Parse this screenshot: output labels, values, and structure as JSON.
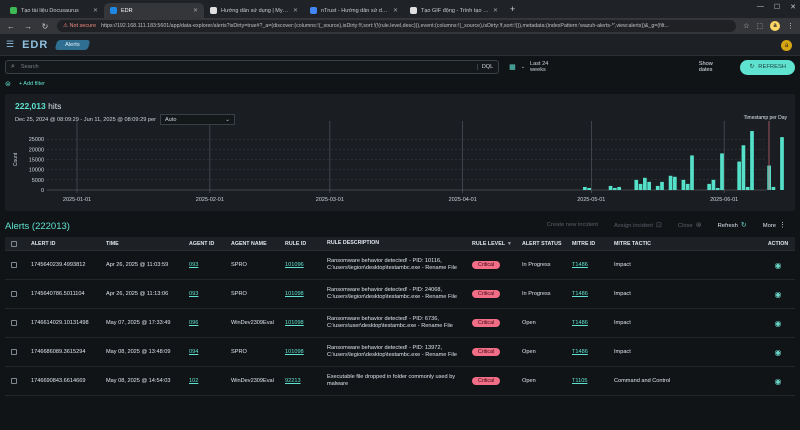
{
  "browser": {
    "tabs": [
      {
        "title": "Tạo tài liệu Docusaurus",
        "color": "#3cba54",
        "active": false
      },
      {
        "title": "EDR",
        "color": "#1e88e5",
        "active": true
      },
      {
        "title": "Hướng dẫn sử dụng | My EDR",
        "color": "#e0e0e0",
        "active": false
      },
      {
        "title": "nTrust - Hướng dẫn sử dụng",
        "color": "#4285f4",
        "active": false
      },
      {
        "title": "Tạo GIF động - Trình tạo GIF tr...",
        "color": "#e0e0e0",
        "active": false
      }
    ],
    "not_secure": "Not secure",
    "url": "https://192.168.111.183:5601/app/data-explorer/alerts?isDirty=true#?_a=(discover:(columns:!(_source),isDirty:!f,sort:!(!(rule.level,desc))),event:(columns:!(_source),isDirty:!f,sort:!()),metadata:(indexPattern:'wazuh-alerts-*',view:alerts))&_g=(filt...",
    "profile_initial": "a"
  },
  "app": {
    "logo": "EDR",
    "breadcrumb": "Alerts",
    "avatar": "a"
  },
  "query": {
    "placeholder": "Search",
    "dql": "DQL",
    "time_range": "Last 24 weeks",
    "show_dates": "Show dates",
    "refresh": "REFRESH",
    "add_filter": "+ Add filter"
  },
  "histogram": {
    "hits_value": "222,013",
    "hits_label": " hits",
    "date_range": "Dec 25, 2024 @ 08:09:29 - Jun 11, 2025 @ 08:09:29 per",
    "interval": "Auto",
    "corner_label": "Timestamp per Day"
  },
  "chart_data": {
    "type": "bar",
    "ylabel": "Count",
    "xlabel": "Timestamp per Day",
    "ylim": [
      0,
      30000
    ],
    "y_ticks": [
      "0",
      "5000",
      "10000",
      "15000",
      "20000",
      "25000"
    ],
    "x_ticks": [
      "2025-01-01",
      "2025-02-01",
      "2025-03-01",
      "2025-04-01",
      "2025-05-01",
      "2025-06-01"
    ],
    "x_start": "2024-12-25",
    "x_end": "2025-06-11",
    "values": [
      0,
      0,
      0,
      0,
      0,
      0,
      0,
      0,
      0,
      0,
      0,
      0,
      0,
      0,
      0,
      0,
      0,
      0,
      0,
      0,
      0,
      0,
      0,
      0,
      0,
      0,
      0,
      0,
      0,
      0,
      0,
      0,
      0,
      0,
      0,
      0,
      0,
      0,
      0,
      0,
      0,
      0,
      0,
      0,
      0,
      0,
      0,
      0,
      0,
      0,
      0,
      0,
      0,
      0,
      0,
      0,
      0,
      0,
      0,
      0,
      0,
      0,
      0,
      0,
      0,
      0,
      0,
      0,
      0,
      0,
      0,
      0,
      0,
      0,
      0,
      0,
      0,
      0,
      0,
      0,
      0,
      0,
      0,
      0,
      0,
      0,
      0,
      0,
      0,
      0,
      0,
      0,
      0,
      0,
      0,
      0,
      0,
      0,
      0,
      0,
      0,
      0,
      0,
      0,
      0,
      0,
      0,
      0,
      0,
      0,
      0,
      0,
      0,
      0,
      0,
      0,
      0,
      0,
      0,
      0,
      0,
      0,
      0,
      0,
      0,
      1500,
      1000,
      0,
      0,
      0,
      0,
      2000,
      1000,
      1500,
      0,
      0,
      0,
      5000,
      3000,
      6000,
      4000,
      0,
      2000,
      4000,
      0,
      7000,
      6500,
      0,
      5000,
      3000,
      17000,
      0,
      0,
      0,
      3000,
      5000,
      1000,
      18000,
      0,
      0,
      0,
      14000,
      22000,
      1500,
      29000,
      0,
      0,
      0,
      12000,
      1500,
      0,
      26000,
      0,
      0,
      0,
      13000,
      1000,
      12500,
      0,
      500
    ],
    "bar_color": "#54e0c9"
  },
  "alerts": {
    "title": "Alerts (222013)",
    "actions": {
      "create": "Create new incident",
      "assign": "Assign incident",
      "close": "Close",
      "refresh": "Refresh",
      "more": "More"
    },
    "columns": [
      "ALERT ID",
      "TIME",
      "AGENT ID",
      "AGENT NAME",
      "RULE ID",
      "RULE DESCRIPTION",
      "RULE LEVEL",
      "ALERT STATUS",
      "MITRE ID",
      "MITRE TACTIC",
      "ACTION"
    ],
    "rows": [
      {
        "alert_id": "1745640239.4993812",
        "time": "Apr 26, 2025 @ 11:03:59",
        "agent_id": "093",
        "agent_name": "SPRO",
        "rule_id": "101096",
        "description": "Ransomware behavior detected! - PID: 10116, C:\\users\\legion\\desktop\\testambc.exe - Rename File",
        "level": "Critical",
        "status": "In Progress",
        "mitre_id": "T1486",
        "tactic": "Impact"
      },
      {
        "alert_id": "1745640786.5011104",
        "time": "Apr 26, 2025 @ 11:13:06",
        "agent_id": "093",
        "agent_name": "SPRO",
        "rule_id": "101098",
        "description": "Ransomware behavior detected! - PID: 24068, C:\\users\\legion\\desktop\\testambc.exe - Rename File",
        "level": "Critical",
        "status": "In Progress",
        "mitre_id": "T1486",
        "tactic": "Impact"
      },
      {
        "alert_id": "1746614029.10131498",
        "time": "May 07, 2025 @ 17:33:49",
        "agent_id": "096",
        "agent_name": "WinDev2309Eval",
        "rule_id": "101098",
        "description": "Ransomware behavior detected! - PID: 6736, C:\\users\\user\\desktop\\testambc.exe - Rename File",
        "level": "Critical",
        "status": "Open",
        "mitre_id": "T1486",
        "tactic": "Impact"
      },
      {
        "alert_id": "1746686089.3615294",
        "time": "May 08, 2025 @ 13:48:09",
        "agent_id": "094",
        "agent_name": "SPRO",
        "rule_id": "101098",
        "description": "Ransomware behavior detected! - PID: 13972, C:\\users\\legion\\desktop\\testambc.exe - Rename File",
        "level": "Critical",
        "status": "Open",
        "mitre_id": "T1486",
        "tactic": "Impact"
      },
      {
        "alert_id": "1746690843.6614669",
        "time": "May 08, 2025 @ 14:54:03",
        "agent_id": "102",
        "agent_name": "WinDev2309Eval",
        "rule_id": "92213",
        "description": "Executable file dropped in folder commonly used by malware",
        "level": "Critical",
        "status": "Open",
        "mitre_id": "T1105",
        "tactic": "Command and Control"
      }
    ]
  }
}
